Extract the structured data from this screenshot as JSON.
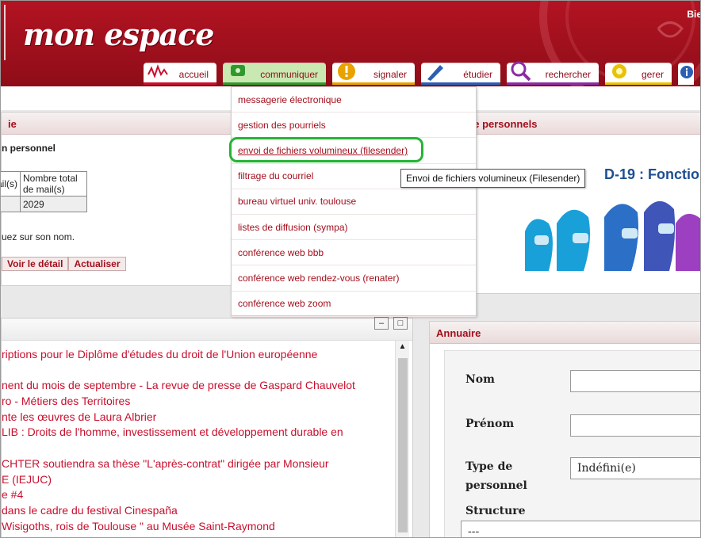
{
  "header": {
    "logo_text": "mon espace",
    "greeting": "Bie"
  },
  "nav": {
    "tabs": [
      {
        "label": "accueil",
        "icon": "wave-icon",
        "color": "#c8102e"
      },
      {
        "label": "communiquer",
        "icon": "phone-icon",
        "color": "#2e9a2e",
        "active": true
      },
      {
        "label": "signaler",
        "icon": "warning-icon",
        "color": "#e8a300"
      },
      {
        "label": "étudier",
        "icon": "pen-icon",
        "color": "#2b5fb4"
      },
      {
        "label": "rechercher",
        "icon": "magnifier-icon",
        "color": "#8a2ea3"
      },
      {
        "label": "gerer",
        "icon": "gear-icon",
        "color": "#e8c300"
      }
    ]
  },
  "dropdown": {
    "items": [
      "messagerie électronique",
      "gestion des pourriels",
      "envoi de fichiers volumineux (filesender)",
      "filtrage du courriel",
      "bureau virtuel univ. toulouse",
      "listes de diffusion (sympa)",
      "conférence web bbb",
      "conférence web rendez-vous (renater)",
      "conférence web zoom"
    ],
    "highlighted_index": 2,
    "tooltip": "Envoi de fichiers volumineux (Filesender)"
  },
  "mail_panel": {
    "title": "ie",
    "subtitle": "n personnel",
    "table_headers": [
      "ail(s)",
      "Nombre total de mail(s)"
    ],
    "table_values": [
      "",
      "2029"
    ],
    "hint": "uez sur son nom.",
    "actions": [
      "Voir le détail",
      "Actualiser"
    ]
  },
  "espace_panel": {
    "title": "ce personnels",
    "banner_text": "D-19 : Fonction"
  },
  "news_panel": {
    "items": [
      "riptions pour le Diplôme d'études du droit de l'Union européenne",
      "",
      "nent du mois de septembre - La revue de presse de Gaspard Chauvelot",
      "ro - Métiers des Territoires",
      "nte les œuvres de Laura Albrier",
      "LIB : Droits de l'homme, investissement et développement durable en",
      "",
      "CHTER soutiendra sa thèse \"L'après-contrat\" dirigée par Monsieur",
      "E (IEJUC)",
      "e #4",
      "dans le cadre du festival Cinespaña",
      " Wisigoths, rois de Toulouse \" au Musée Saint-Raymond",
      "..."
    ]
  },
  "annuaire": {
    "title": "Annuaire",
    "fields": {
      "nom_label": "Nom",
      "prenom_label": "Prénom",
      "type_label": "Type de personnel",
      "type_value": "Indéfini(e)",
      "structure_label": "Structure",
      "structure_value": "---"
    }
  }
}
